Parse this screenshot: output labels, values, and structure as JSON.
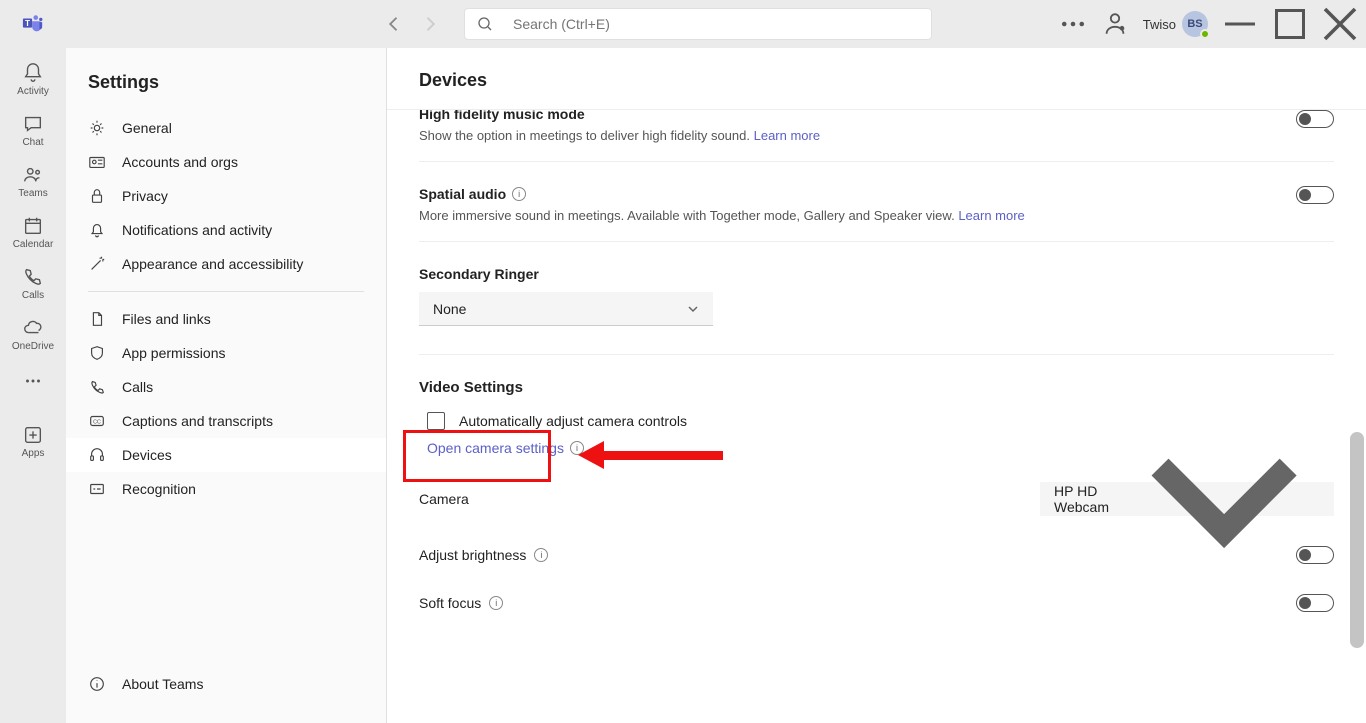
{
  "titlebar": {
    "search_placeholder": "Search (Ctrl+E)",
    "user_name": "Twiso",
    "user_initials": "BS"
  },
  "rail": {
    "items": [
      {
        "label": "Activity",
        "icon": "bell"
      },
      {
        "label": "Chat",
        "icon": "chat"
      },
      {
        "label": "Teams",
        "icon": "teams"
      },
      {
        "label": "Calendar",
        "icon": "calendar"
      },
      {
        "label": "Calls",
        "icon": "phone"
      },
      {
        "label": "OneDrive",
        "icon": "cloud"
      }
    ],
    "more_label": "",
    "apps_label": "Apps"
  },
  "sidebar": {
    "title": "Settings",
    "group1": [
      {
        "label": "General"
      },
      {
        "label": "Accounts and orgs"
      },
      {
        "label": "Privacy"
      },
      {
        "label": "Notifications and activity"
      },
      {
        "label": "Appearance and accessibility"
      }
    ],
    "group2": [
      {
        "label": "Files and links"
      },
      {
        "label": "App permissions"
      },
      {
        "label": "Calls"
      },
      {
        "label": "Captions and transcripts"
      },
      {
        "label": "Devices"
      },
      {
        "label": "Recognition"
      }
    ],
    "footer": {
      "label": "About Teams"
    }
  },
  "main": {
    "title": "Devices",
    "hf": {
      "title": "High fidelity music mode",
      "desc": "Show the option in meetings to deliver high fidelity sound.",
      "learn": "Learn more"
    },
    "spatial": {
      "title": "Spatial audio",
      "desc": "More immersive sound in meetings. Available with Together mode, Gallery and Speaker view.",
      "learn": "Learn more"
    },
    "ringer": {
      "title": "Secondary Ringer",
      "value": "None"
    },
    "video": {
      "title": "Video Settings",
      "auto_adjust": "Automatically adjust camera controls",
      "open_settings": "Open camera settings",
      "camera_label": "Camera",
      "camera_value": "HP HD Webcam",
      "brightness": "Adjust brightness",
      "soft_focus": "Soft focus"
    }
  }
}
